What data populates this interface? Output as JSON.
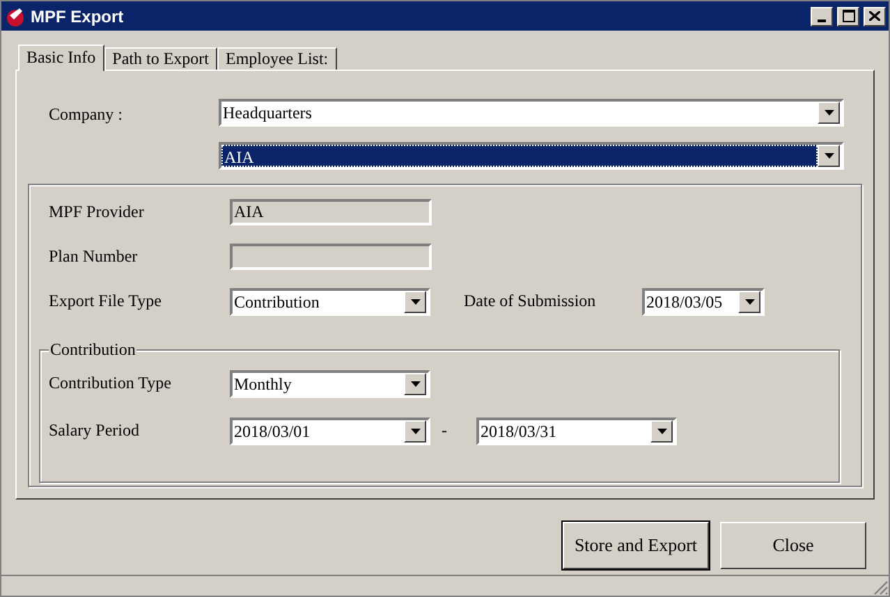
{
  "window": {
    "title": "MPF Export"
  },
  "tabs": [
    {
      "label": "Basic Info",
      "selected": true
    },
    {
      "label": "Path to Export",
      "selected": false
    },
    {
      "label": "Employee List:",
      "selected": false
    }
  ],
  "company": {
    "label": "Company :",
    "value": "Headquarters",
    "provider_value": "AIA",
    "provider_focused": true
  },
  "details": [
    {
      "label": "MPF Provider",
      "kind": "text",
      "value": "AIA"
    },
    {
      "label": "Plan Number",
      "kind": "text"
    },
    {
      "label": "Export File Type",
      "kind": "combo",
      "value": "Contribution",
      "side_label": "Date of Submission",
      "side_value": "2018/03/05"
    }
  ],
  "contribution": {
    "title": "Contribution",
    "type_label": "Contribution Type",
    "type_value": "Monthly",
    "period_label": "Salary Period",
    "period_from": "2018/03/01",
    "separator": "-",
    "period_to": "2018/03/31"
  },
  "buttons": [
    {
      "label": "Store and Export",
      "default": true
    },
    {
      "label": "Close",
      "default": false
    }
  ]
}
